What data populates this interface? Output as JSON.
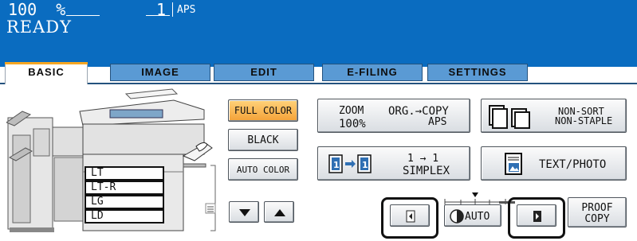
{
  "status": {
    "zoom_value": "100",
    "zoom_unit": "%",
    "copies": "1",
    "mode": "APS",
    "state": "READY"
  },
  "tabs": [
    {
      "label": "BASIC"
    },
    {
      "label": "IMAGE"
    },
    {
      "label": "EDIT"
    },
    {
      "label": "E-FILING"
    },
    {
      "label": "SETTINGS"
    }
  ],
  "color_mode": {
    "full_color": "FULL COLOR",
    "black": "BLACK",
    "auto_color": "AUTO COLOR",
    "selected": "FULL COLOR"
  },
  "zoom_button": {
    "label": "ZOOM",
    "value": "100%",
    "org_copy": "ORG.→COPY",
    "paper": "APS"
  },
  "duplex_button": {
    "mode": "1 → 1",
    "label": "SIMPLEX"
  },
  "finishing_button": {
    "line1": "NON-SORT",
    "line2": "NON-STAPLE"
  },
  "original_mode_button": {
    "label": "TEXT/PHOTO"
  },
  "density": {
    "auto_label": "AUTO"
  },
  "proof_copy": {
    "line1": "PROOF",
    "line2": "COPY"
  },
  "paper_sizes": [
    "LT",
    "LT-R",
    "LG",
    "LD"
  ],
  "colors": {
    "header_bg": "#0a6cc0",
    "tab_bg": "#5a9ad4",
    "selected_button": "#f4a238",
    "tab_accent": "#f5a623"
  }
}
